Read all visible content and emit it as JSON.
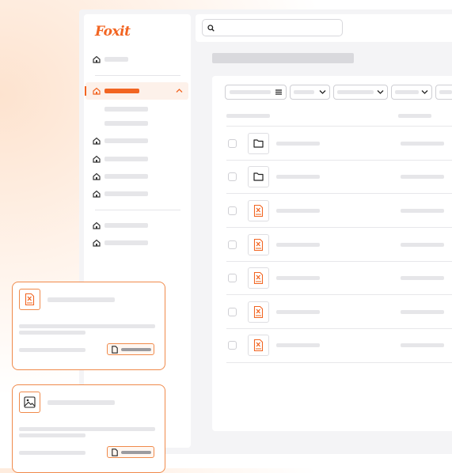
{
  "app": {
    "logo_text": "Foxit",
    "brand_color": "#f26522"
  },
  "search": {
    "placeholder": ""
  },
  "icons": {
    "search": "search-icon",
    "home": "home-icon",
    "folder": "folder-icon",
    "pdf": "pdf-file-icon",
    "image": "image-icon",
    "document": "document-icon",
    "chevron": "chevron-down-icon",
    "list": "list-icon"
  },
  "table": {
    "rows": [
      {
        "type": "folder"
      },
      {
        "type": "folder"
      },
      {
        "type": "pdf"
      },
      {
        "type": "pdf"
      },
      {
        "type": "pdf"
      },
      {
        "type": "pdf"
      },
      {
        "type": "pdf"
      }
    ]
  },
  "cards": [
    {
      "type": "pdf"
    },
    {
      "type": "image"
    }
  ]
}
